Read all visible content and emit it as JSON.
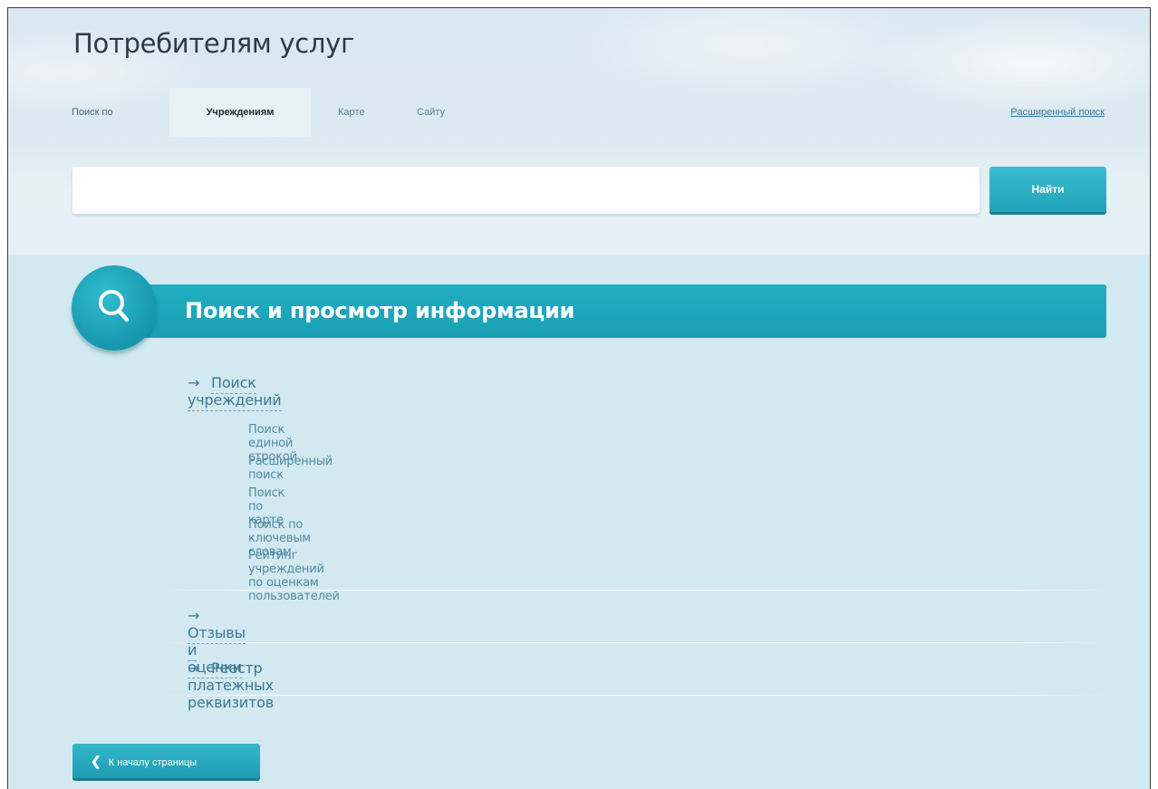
{
  "header": {
    "title": "Потребителям услуг",
    "tabs": [
      {
        "label": "Поиск по"
      },
      {
        "label": "Учреждениям"
      },
      {
        "label": "Карте"
      },
      {
        "label": "Сайту"
      }
    ],
    "advanced_link": "Расширенный поиск"
  },
  "search": {
    "value": "",
    "button_label": "Найти"
  },
  "panel": {
    "title": "Поиск и просмотр информации",
    "icon": "search-icon",
    "sections": [
      {
        "label": "Поиск учреждений",
        "items": [
          "Поиск единой строкой",
          "Расширенный поиск",
          "Поиск по карте",
          "Поиск по ключевым словам",
          "Рейтинг учреждений по оценкам пользователей"
        ]
      },
      {
        "label": "Отзывы и оценки"
      },
      {
        "label": "Реестр платежных реквизитов"
      }
    ]
  },
  "footer": {
    "back_label": "К началу страницы"
  },
  "colors": {
    "accent": "#1fa6bb",
    "link": "#3a7894",
    "title": "#2d3a42"
  }
}
